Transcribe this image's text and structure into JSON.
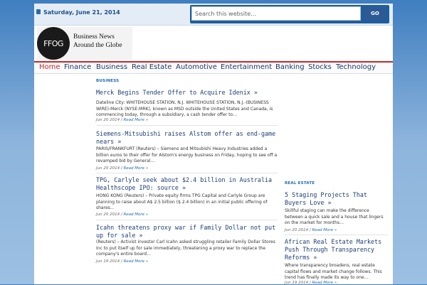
{
  "header": {
    "date": "Saturday, June 21, 2014",
    "search": {
      "placeholder": "Search this website…",
      "button_label": "GO"
    }
  },
  "logo": {
    "mark": "FFOG",
    "line1": "Business News",
    "line2": "Around the Globe"
  },
  "nav": {
    "items": [
      {
        "label": "Home",
        "active": true
      },
      {
        "label": "Finance"
      },
      {
        "label": "Business"
      },
      {
        "label": "Real Estate"
      },
      {
        "label": "Automotive"
      },
      {
        "label": "Entertainment"
      },
      {
        "label": "Banking"
      },
      {
        "label": "Stocks"
      },
      {
        "label": "Technology"
      }
    ]
  },
  "business": {
    "label": "BUSINESS",
    "posts": [
      {
        "title": "Merck Begins Tender Offer to Acquire Idenix »",
        "excerpt": "Dateline City: WHITEHOUSE STATION, N.J. WHITEHOUSE STATION, N.J.-(BUSINESS WIRE)-Merck (NYSE:MRK), known as MSD outside the United States and Canada, is commencing today, through a subsidiary, a cash tender offer to…",
        "date": "Jun 20 2014",
        "more": "Read More »"
      },
      {
        "title": "Siemens-Mitsubishi raises Alstom offer as end-game nears »",
        "excerpt": "PARIS/FRANKFURT (Reuters) – Siemens and Mitsubishi Heavy Industries added a billion euros to their offer for Alstom's energy business on Friday, hoping to see off a revamped bid by General…",
        "date": "Jun 20 2014",
        "more": "Read More »"
      },
      {
        "title": "TPG, Carlyle seek about $2.4 billion in Australia Healthscope IPO: source »",
        "excerpt": "HONG KONG (Reuters) – Private equity firms TPG Capital and Carlyle Group are planning to raise about A$ 2.5 billion ($ 2.4 billion) in an initial public offering of shares…",
        "date": "Jun 20 2014",
        "more": "Read More »"
      },
      {
        "title": "Icahn threatens proxy war if Family Dollar not put up for sale »",
        "excerpt": "(Reuters) – Activist investor Carl Icahn asked struggling retailer Family Dollar Stores Inc to put itself up for sale immediately, threatening a proxy war to replace the company's entire board…",
        "date": "Jun 19 2014",
        "more": "Read More »"
      }
    ]
  },
  "real_estate": {
    "label": "REAL ESTATE",
    "posts": [
      {
        "title": "5 Staging Projects That Buyers Love »",
        "excerpt": "Skillful staging can make the difference between a quick sale and a house that lingers on the market for months…",
        "date": "Jun 20 2014",
        "more": "Read More »"
      },
      {
        "title": "African Real Estate Markets Push Through Transparency Reforms »",
        "excerpt": "Where transparency broadens, real estate capital flows and market change follows. This trend has finally made its way to one…",
        "date": "Jun 19 2014",
        "more": "Read More »"
      }
    ]
  }
}
